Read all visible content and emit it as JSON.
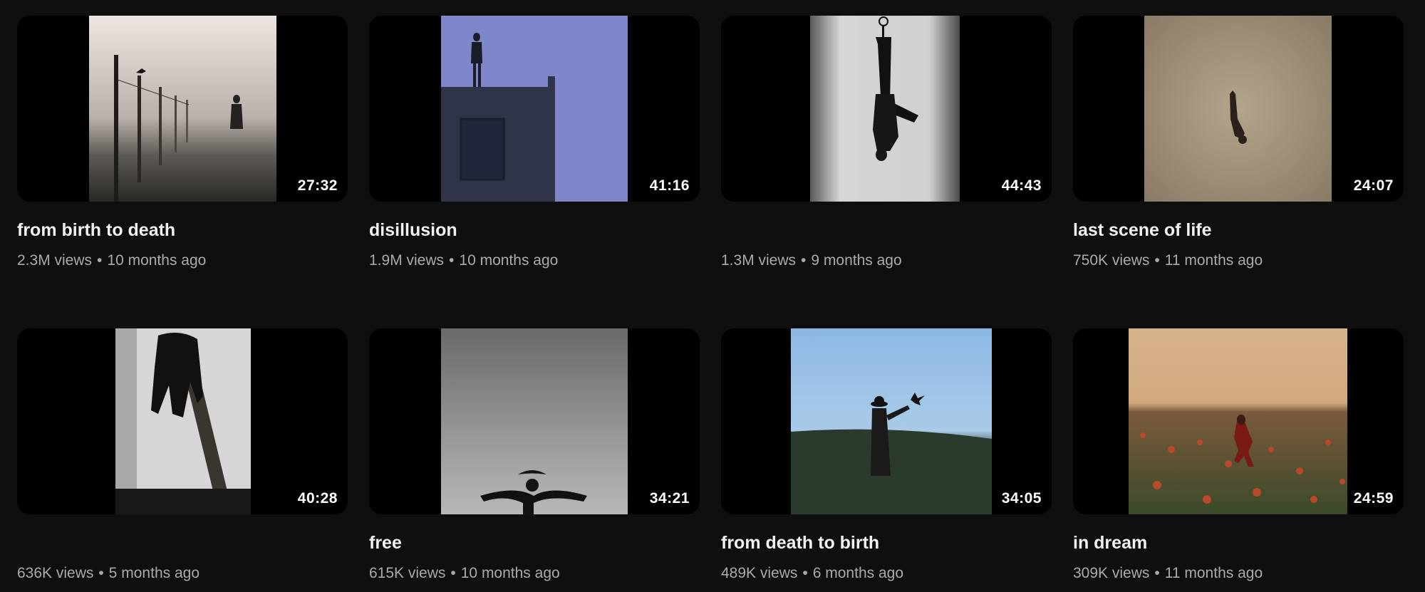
{
  "videos": [
    {
      "title": "from birth to death",
      "duration": "27:32",
      "views": "2.3M views",
      "age": "10 months ago"
    },
    {
      "title": "disillusion",
      "duration": "41:16",
      "views": "1.9M views",
      "age": "10 months ago"
    },
    {
      "title": "",
      "duration": "44:43",
      "views": "1.3M views",
      "age": "9 months ago"
    },
    {
      "title": "last scene of life",
      "duration": "24:07",
      "views": "750K views",
      "age": "11 months ago"
    },
    {
      "title": "",
      "duration": "40:28",
      "views": "636K views",
      "age": "5 months ago"
    },
    {
      "title": "free",
      "duration": "34:21",
      "views": "615K views",
      "age": "10 months ago"
    },
    {
      "title": "from death to birth",
      "duration": "34:05",
      "views": "489K views",
      "age": "6 months ago"
    },
    {
      "title": "in dream",
      "duration": "24:59",
      "views": "309K views",
      "age": "11 months ago"
    }
  ],
  "separator": "•"
}
